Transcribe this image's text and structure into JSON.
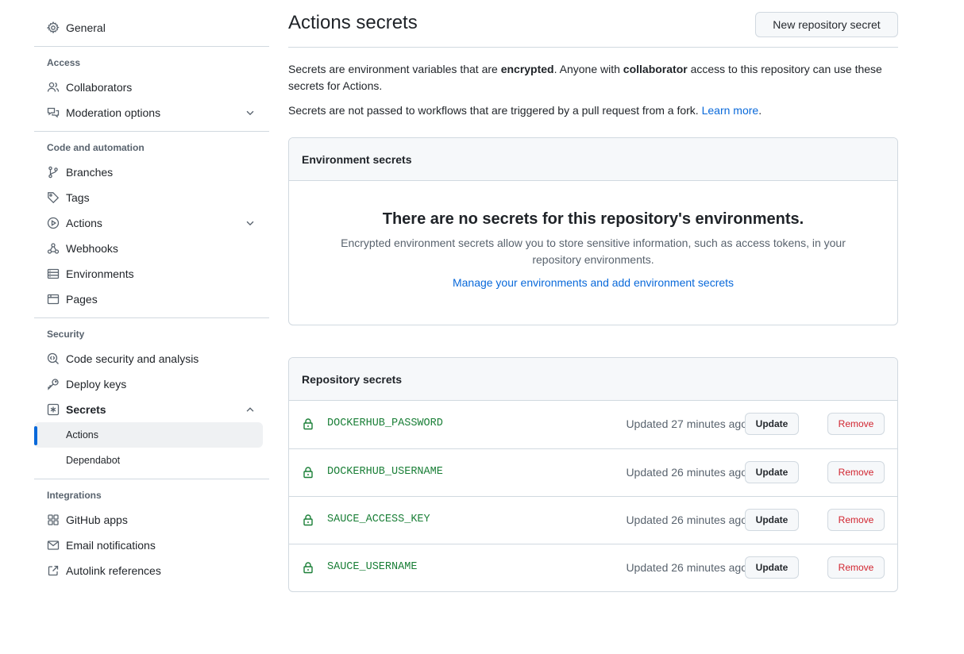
{
  "sidebar": {
    "general": "General",
    "access_label": "Access",
    "collaborators": "Collaborators",
    "moderation": "Moderation options",
    "code_label": "Code and automation",
    "branches": "Branches",
    "tags": "Tags",
    "actions": "Actions",
    "webhooks": "Webhooks",
    "environments": "Environments",
    "pages": "Pages",
    "security_label": "Security",
    "code_security": "Code security and analysis",
    "deploy_keys": "Deploy keys",
    "secrets": "Secrets",
    "secrets_actions": "Actions",
    "secrets_dependabot": "Dependabot",
    "integrations_label": "Integrations",
    "github_apps": "GitHub apps",
    "email_notifications": "Email notifications",
    "autolink": "Autolink references"
  },
  "main": {
    "title": "Actions secrets",
    "new_secret_button": "New repository secret",
    "desc_part1": "Secrets are environment variables that are ",
    "desc_bold1": "encrypted",
    "desc_part2": ". Anyone with ",
    "desc_bold2": "collaborator",
    "desc_part3": " access to this repository can use these secrets for Actions.",
    "fork_note": "Secrets are not passed to workflows that are triggered by a pull request from a fork. ",
    "learn_more": "Learn more",
    "fork_note_end": ".",
    "env_header": "Environment secrets",
    "env_empty_title": "There are no secrets for this repository's environments.",
    "env_empty_desc": "Encrypted environment secrets allow you to store sensitive information, such as access tokens, in your repository environments.",
    "env_manage_link": "Manage your environments and add environment secrets",
    "repo_header": "Repository secrets",
    "update_label": "Update",
    "remove_label": "Remove",
    "secrets": [
      {
        "name": "DOCKERHUB_PASSWORD",
        "updated": "Updated 27 minutes ago"
      },
      {
        "name": "DOCKERHUB_USERNAME",
        "updated": "Updated 26 minutes ago"
      },
      {
        "name": "SAUCE_ACCESS_KEY",
        "updated": "Updated 26 minutes ago"
      },
      {
        "name": "SAUCE_USERNAME",
        "updated": "Updated 26 minutes ago"
      }
    ]
  },
  "colors": {
    "accent": "#0969da",
    "secret_name": "#1a7f37",
    "danger": "#d1242f",
    "muted": "#59636e",
    "border": "#d1d9e0"
  },
  "icons": [
    "gear-icon",
    "people-icon",
    "comment-discussion-icon",
    "chevron-down-icon",
    "git-branch-icon",
    "tag-icon",
    "play-icon",
    "webhook-icon",
    "server-icon",
    "browser-icon",
    "codescan-icon",
    "key-icon",
    "key-asterisk-icon",
    "chevron-up-icon",
    "apps-icon",
    "mail-icon",
    "link-external-icon",
    "lock-icon"
  ]
}
